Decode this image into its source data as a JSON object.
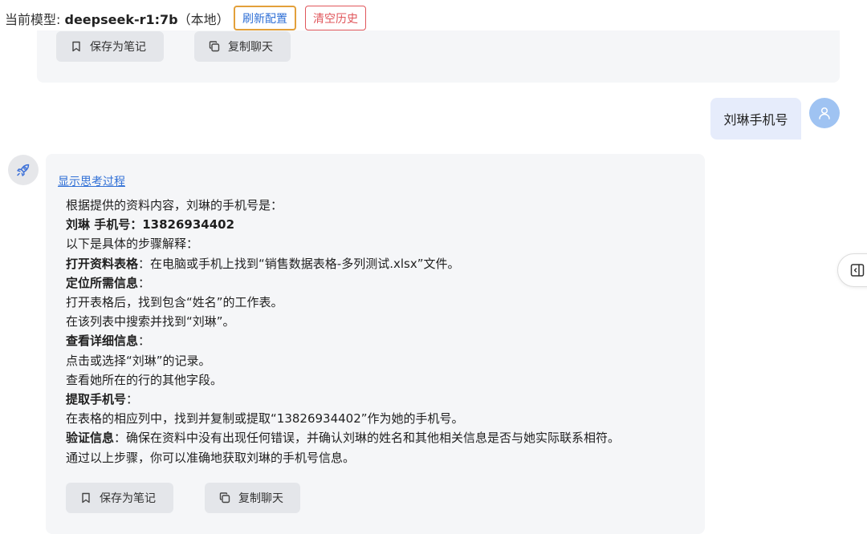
{
  "header": {
    "model_prefix": "当前模型: ",
    "model_name": "deepseek-r1:7b",
    "model_suffix": "（本地）",
    "refresh_label": "刷新配置",
    "clear_label": "清空历史"
  },
  "previous_message": {
    "save_note_label": "保存为笔记",
    "copy_chat_label": "复制聊天"
  },
  "user_message": {
    "text": "刘琳手机号"
  },
  "bot_message": {
    "show_thinking_label": "显示思考过程",
    "lines": [
      {
        "bold": "",
        "text": "根据提供的资料内容，刘琳的手机号是："
      },
      {
        "bold": "刘琳 手机号：13826934402",
        "text": ""
      },
      {
        "bold": "",
        "text": "以下是具体的步骤解释："
      },
      {
        "bold": "打开资料表格",
        "text": "：在电脑或手机上找到“销售数据表格-多列测试.xlsx”文件。"
      },
      {
        "bold": "定位所需信息",
        "text": "："
      },
      {
        "bold": "",
        "text": "打开表格后，找到包含“姓名”的工作表。"
      },
      {
        "bold": "",
        "text": "在该列表中搜索并找到“刘琳”。"
      },
      {
        "bold": "查看详细信息",
        "text": "："
      },
      {
        "bold": "",
        "text": "点击或选择“刘琳”的记录。"
      },
      {
        "bold": "",
        "text": "查看她所在的行的其他字段。"
      },
      {
        "bold": "提取手机号",
        "text": "："
      },
      {
        "bold": "",
        "text": "在表格的相应列中，找到并复制或提取“13826934402”作为她的手机号。"
      },
      {
        "bold": "验证信息",
        "text": "：确保在资料中没有出现任何错误，并确认刘琳的姓名和其他相关信息是否与她实际联系相符。"
      },
      {
        "bold": "",
        "text": "通过以上步骤，你可以准确地获取刘琳的手机号信息。"
      }
    ],
    "save_note_label": "保存为笔记",
    "copy_chat_label": "复制聊天"
  },
  "icons": {
    "bookmark": "bookmark-icon",
    "copy": "copy-icon",
    "user": "user-icon",
    "rocket": "rocket-icon",
    "sidebar_toggle": "sidebar-toggle-icon"
  },
  "colors": {
    "accent_blue": "#2f6fd6",
    "refresh_border": "#e3a03a",
    "clear_red": "#e0565b",
    "user_bubble": "#e6ecfb",
    "card_bg": "#f5f6f8",
    "user_avatar": "#9fc3f2"
  }
}
